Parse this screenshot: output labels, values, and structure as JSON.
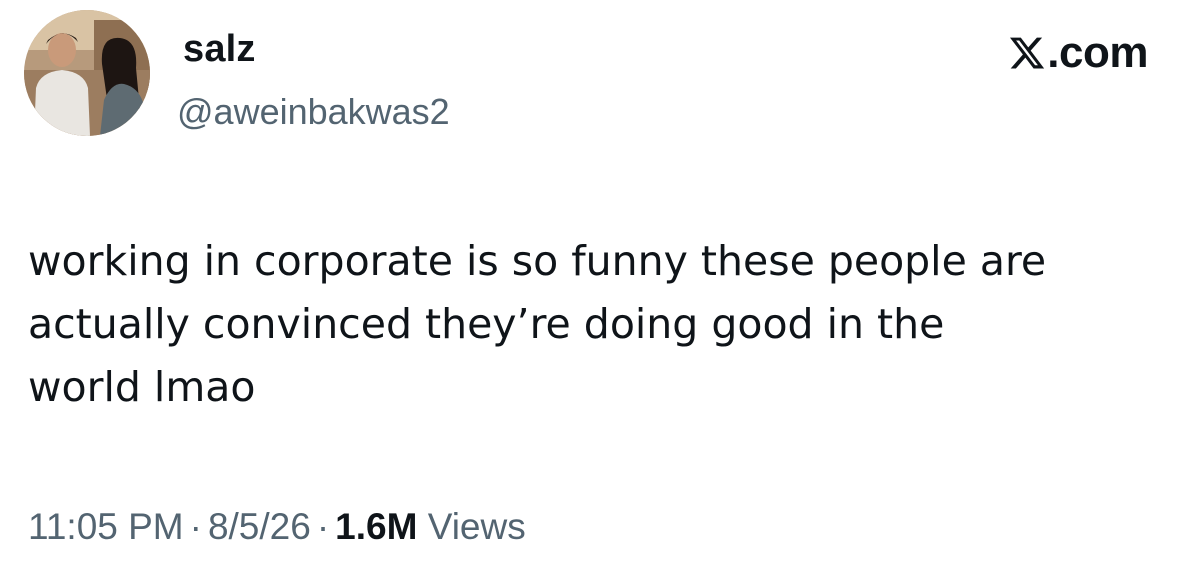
{
  "tweet": {
    "author": {
      "display_name": "salz",
      "handle": "@aweinbakwas2",
      "avatar": "profile-photo"
    },
    "brand": {
      "icon": "x-logo-icon",
      "domain": ".com"
    },
    "text_lines": [
      "working in corporate is so funny these people are",
      "actually convinced they’re doing good in the",
      "world lmao"
    ],
    "meta": {
      "time": "11:05 PM",
      "separator": "·",
      "date": "8/5/26",
      "views_count": "1.6M",
      "views_label": "Views"
    }
  },
  "colors": {
    "text_primary": "#0f1419",
    "text_secondary": "#536471",
    "background": "#ffffff"
  }
}
